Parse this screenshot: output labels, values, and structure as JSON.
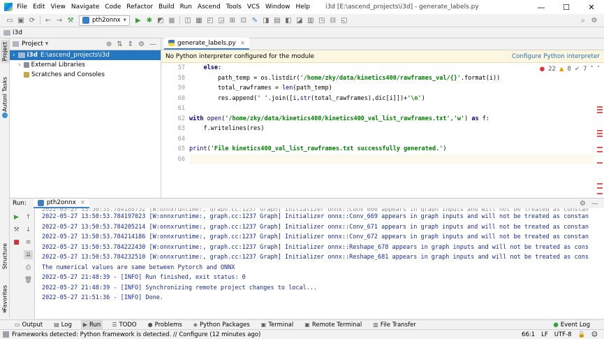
{
  "window": {
    "menu": [
      "File",
      "Edit",
      "View",
      "Navigate",
      "Code",
      "Refactor",
      "Build",
      "Run",
      "Ascend",
      "Tools",
      "VCS",
      "Window",
      "Help"
    ],
    "title": "i3d [E:\\ascend_projects\\i3d] - generate_labels.py",
    "minimize": "—",
    "maximize": "☐",
    "close": "✕"
  },
  "toolbar": {
    "run_config": "pth2onnx"
  },
  "breadcrumb": {
    "project": "i3d"
  },
  "left_strip": {
    "project_tab": "Project",
    "ascend_tab": "Autonl Tasks",
    "structure_tab": "Structure",
    "favorites_tab": "Favorites"
  },
  "project_panel": {
    "title": "Project",
    "items": [
      {
        "name": "i3d",
        "path": "E:\\ascend_projects\\i3d"
      },
      {
        "name": "External Libraries"
      },
      {
        "name": "Scratches and Consoles"
      }
    ]
  },
  "editor": {
    "tab": "generate_labels.py",
    "notice": "No Python interpreter configured for the module",
    "notice_link": "Configure Python interpreter",
    "inspections": {
      "errors": "22",
      "warnings": "8",
      "weak": "7"
    },
    "line_numbers": [
      "57",
      "58",
      "59",
      "60",
      "61",
      "62",
      "63",
      "64",
      "65",
      "66"
    ]
  },
  "run_panel": {
    "label": "Run:",
    "tab": "pth2onnx",
    "lines": [
      "2022-05-27 13:50:53.784197023 [W:onnxruntime:, graph.cc:1237 Graph] Initializer onnx::Conv_669 appears in graph inputs and will not be treated as constan",
      "2022-05-27 13:50:53.784205214 [W:onnxruntime:, graph.cc:1237 Graph] Initializer onnx::Conv_671 appears in graph inputs and will not be treated as constan",
      "2022-05-27 13:50:53.784214186 [W:onnxruntime:, graph.cc:1237 Graph] Initializer onnx::Conv_672 appears in graph inputs and will not be treated as constan",
      "2022-05-27 13:50:53.784222430 [W:onnxruntime:, graph.cc:1237 Graph] Initializer onnx::Reshape_678 appears in graph inputs and will not be treated as cons",
      "2022-05-27 13:50:53.784232510 [W:onnxruntime:, graph.cc:1237 Graph] Initializer onnx::Reshape_681 appears in graph inputs and will not be treated as cons",
      "The numerical values are same between Pytorch and ONNX",
      "2022-05-27 21:48:39 - [INFO] Run finished, exit status: 0",
      "2022-05-27 21:48:39 - [INFO] Synchronizing remote project changes to local...",
      "2022-05-27 21:51:36 - [INFO] Done."
    ]
  },
  "bottom_tabs": [
    "Output",
    "Log",
    "Run",
    "TODO",
    "Problems",
    "Python Packages",
    "Terminal",
    "Remote Terminal",
    "File Transfer"
  ],
  "event_log": "Event Log",
  "status": {
    "message": "Frameworks detected: Python framework is detected. // Configure (12 minutes ago)",
    "position": "66:1",
    "line_sep": "LF",
    "encoding": "UTF-8"
  },
  "colors": {
    "accent": "#2675bf",
    "string": "#008000",
    "keyword": "#000080",
    "console": "#1a2b8f"
  }
}
